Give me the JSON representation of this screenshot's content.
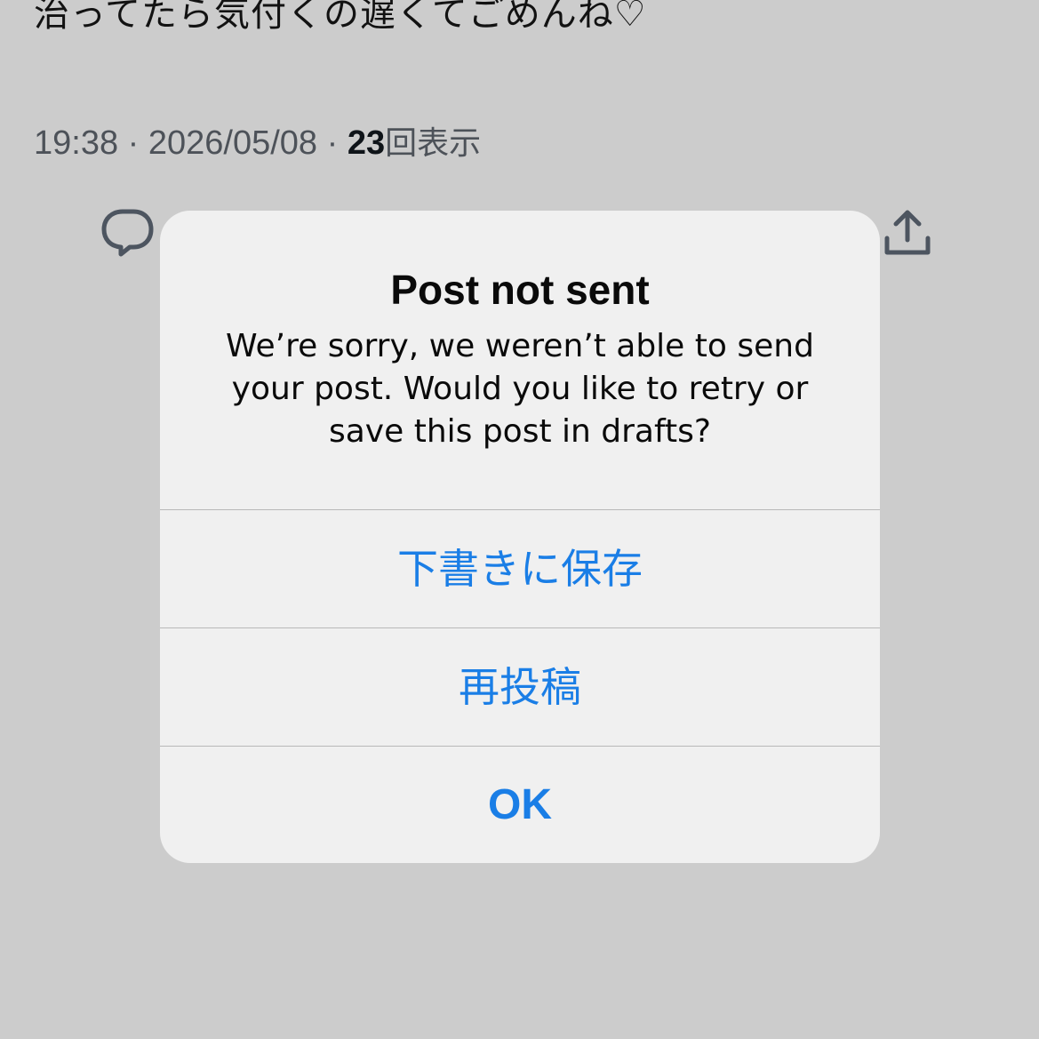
{
  "post": {
    "text": "治ってたら気付くの遅くてごめんね♡",
    "time": "19:38",
    "date": "2026/05/08",
    "separator": "·",
    "views_count": "23",
    "views_label": "回表示"
  },
  "actions": {
    "reply_icon": "speech-bubble-icon",
    "share_icon": "share-upload-icon"
  },
  "dialog": {
    "title": "Post not sent",
    "message": "We’re sorry, we weren’t able to send your post. Would you like to retry or save this post in drafts?",
    "buttons": {
      "save_drafts": "下書きに保存",
      "retry": "再投稿",
      "ok": "OK"
    }
  },
  "colors": {
    "overlay_background": "#cccccc",
    "dialog_background": "#f0f0f0",
    "button_accent": "#1a7ee6"
  }
}
